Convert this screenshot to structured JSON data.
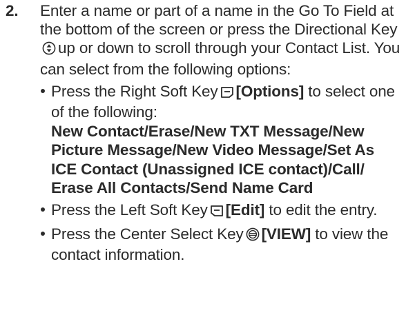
{
  "step": {
    "number": "2.",
    "text_before_icon": "Enter a name or part of a name in the Go To Field at the bottom of the screen or press the Directional Key",
    "text_after_icon": "up or down to scroll through your Contact List. You can select from the following options:"
  },
  "bullets": [
    {
      "prefix": "Press the Right Soft Key",
      "icon": "right-soft-key-icon",
      "bold_label": "[Options]",
      "suffix": "to select one of the following:",
      "sub_bold": "New Contact/Erase/New TXT Message/New Picture Message/New Video Message/Set As ICE Contact (Unassigned ICE contact)/Call/ Erase All Contacts/Send Name Card"
    },
    {
      "prefix": "Press the Left Soft Key",
      "icon": "left-soft-key-icon",
      "bold_label": "[Edit]",
      "suffix": "to edit the entry."
    },
    {
      "prefix": "Press the Center Select Key",
      "icon": "center-select-key-icon",
      "bold_label": "[VIEW]",
      "suffix": "to view the contact information."
    }
  ],
  "icons": {
    "directional_key": "directional-key-icon"
  }
}
